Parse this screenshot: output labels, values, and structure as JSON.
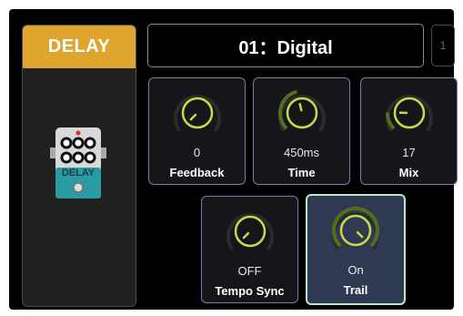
{
  "effect": {
    "title": "DELAY",
    "pedal_label": "DELAY"
  },
  "preset": {
    "name": "01：Digital",
    "bank_number": "1"
  },
  "params": [
    {
      "label": "Feedback",
      "value": "0",
      "level": 0.0
    },
    {
      "label": "Time",
      "value": "450ms",
      "level": 0.45
    },
    {
      "label": "Mix",
      "value": "17",
      "level": 0.17
    },
    {
      "label": "Tempo Sync",
      "value": "OFF",
      "level": 0.0
    },
    {
      "label": "Trail",
      "value": "On",
      "level": 1.0
    }
  ],
  "colors": {
    "accent": "#e0a52e",
    "knob_ring": "#c8d94a",
    "knob_track": "#4f6f1f",
    "active_border": "#b9e7c9"
  }
}
